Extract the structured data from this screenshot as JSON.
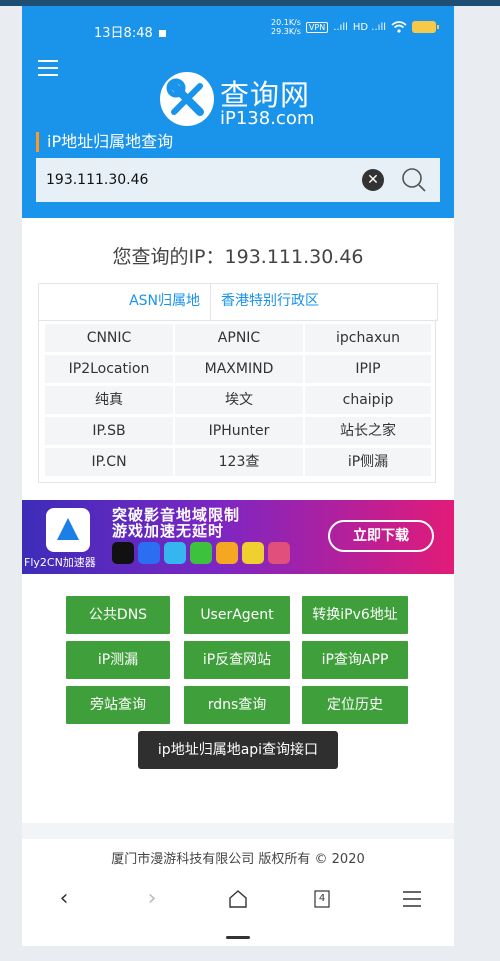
{
  "status_bar": {
    "time": "13日8:48",
    "speed_up": "20.1K/s",
    "speed_down": "29.3K/s",
    "vpn": "VPN",
    "signal1": "..ıll",
    "signal2": "HD ..ıll"
  },
  "header": {
    "brand": "查询网",
    "domain": "iP138.com",
    "section_title": "iP地址归属地查询"
  },
  "search": {
    "value": "193.111.30.46"
  },
  "result": {
    "title": "您查询的IP：193.111.30.46",
    "asn_label": "ASN归属地",
    "asn_value": "香港特别行政区"
  },
  "sources": [
    "CNNIC",
    "APNIC",
    "ipchaxun",
    "IP2Location",
    "MAXMIND",
    "IPIP",
    "纯真",
    "埃文",
    "chaipip",
    "IP.SB",
    "IPHunter",
    "站长之家",
    "IP.CN",
    "123查",
    "iP侧漏"
  ],
  "banner": {
    "tagline_1": "突破影音地域限制",
    "tagline_2": "游戏加速无延时",
    "download": "立即下载",
    "app_name": "Fly2CN加速器"
  },
  "tools": [
    "公共DNS",
    "UserAgent",
    "转换iPv6地址",
    "iP测漏",
    "iP反查网站",
    "iP查询APP",
    "旁站查询",
    "rdns查询",
    "定位历史"
  ],
  "api_button": "ip地址归属地api查询接口",
  "footer": {
    "copyright": "厦门市漫游科技有限公司   版权所有 © 2020"
  },
  "nav": {
    "back": "‹",
    "forward": "›",
    "tabs_count": "4"
  },
  "colors": {
    "header_bg": "#1a93eb",
    "tool_green": "#3f9f3b",
    "accent_orange": "#ff9a1f"
  }
}
